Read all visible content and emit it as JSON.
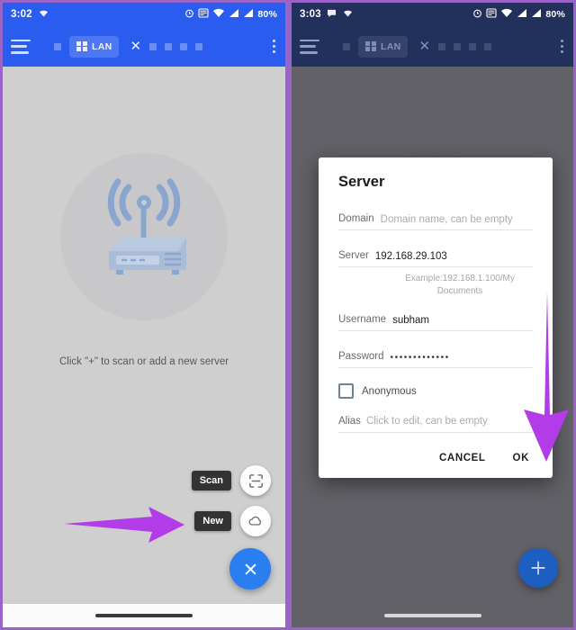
{
  "left_panel": {
    "statusbar": {
      "clock": "3:02",
      "battery": "80%",
      "icons": [
        "wifi-icon",
        "alarm-icon",
        "mute-icon",
        "wifi-signal-icon",
        "cellular-signal-icon",
        "cellular-signal-2-icon"
      ]
    },
    "appbar": {
      "menu_icon": "hamburger-menu-icon",
      "chip_label": "LAN",
      "chip_close_icon": "close-icon",
      "overflow_icon": "kebab-menu-icon"
    },
    "empty_state": {
      "illustration": "wifi-router-icon",
      "hint": "Click \"+\" to scan or add a new server"
    },
    "fab_menu": {
      "items": [
        {
          "label": "Scan",
          "icon": "scan-frame-icon"
        },
        {
          "label": "New",
          "icon": "cloud-icon"
        }
      ],
      "close_icon": "close-icon"
    },
    "annotation": {
      "arrow": "arrow-right-icon",
      "color": "#b23ce8"
    },
    "navbar": {
      "gesture_pill": "home-gesture-pill"
    }
  },
  "right_panel": {
    "statusbar": {
      "clock": "3:03",
      "battery": "80%",
      "icons": [
        "chat-bubble-icon",
        "wifi-icon",
        "alarm-icon",
        "mute-icon",
        "wifi-signal-icon",
        "cellular-signal-icon",
        "cellular-signal-2-icon"
      ]
    },
    "appbar": {
      "menu_icon": "hamburger-menu-icon",
      "chip_label": "LAN",
      "chip_close_icon": "close-icon",
      "overflow_icon": "kebab-menu-icon"
    },
    "dialog": {
      "title": "Server",
      "fields": [
        {
          "label": "Domain",
          "value": "Domain name, can be empty",
          "is_placeholder": true
        },
        {
          "label": "Server",
          "value": "192.168.29.103",
          "is_placeholder": false
        },
        {
          "label": "Username",
          "value": "subham",
          "is_placeholder": false
        },
        {
          "label": "Password",
          "value": "•••••••••••••",
          "is_placeholder": false
        }
      ],
      "server_help": "Example:192.168.1.100/My Documents",
      "checkbox": {
        "label": "Anonymous",
        "checked": false
      },
      "alias": {
        "label": "Alias",
        "value": "Click to edit, can be empty",
        "is_placeholder": true
      },
      "actions": {
        "cancel": "CANCEL",
        "ok": "OK"
      }
    },
    "fab": {
      "icon": "plus-icon"
    },
    "annotation": {
      "arrow": "arrow-down-icon",
      "color": "#b23ce8"
    },
    "navbar": {
      "gesture_pill": "home-gesture-pill"
    }
  },
  "colors": {
    "appbar_left": "#2b5cf0",
    "appbar_right": "#22305c",
    "accent_blue": "#2a7ef0",
    "annotation_purple": "#b23ce8",
    "frame_purple": "#9a63c7"
  }
}
